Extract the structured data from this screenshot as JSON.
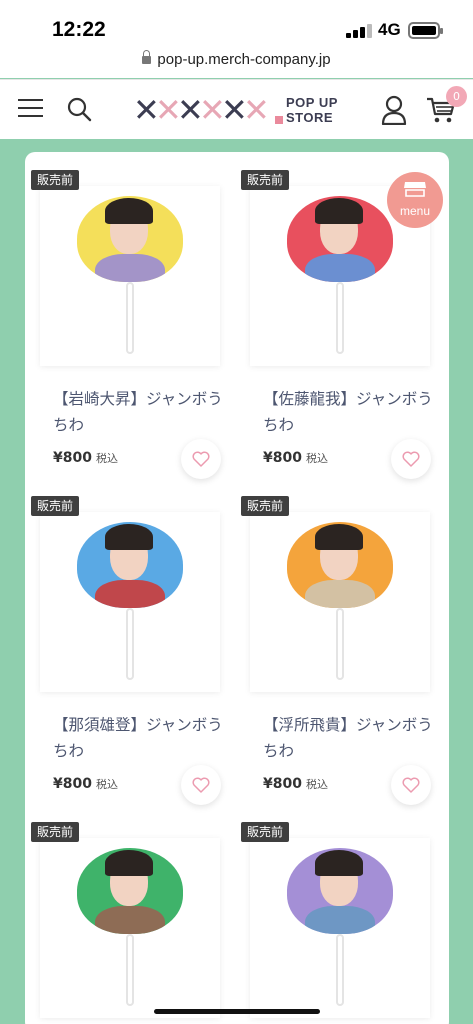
{
  "status_bar": {
    "time": "12:22",
    "network": "4G"
  },
  "browser": {
    "url": "pop-up.merch-company.jp"
  },
  "header": {
    "brand_marks": "✕✕✕✕✕✕",
    "brand_line1": "POP UP",
    "brand_line2": "STORE",
    "cart_count": "0",
    "icons": [
      "hamburger-icon",
      "search-icon",
      "user-icon",
      "cart-icon"
    ]
  },
  "menu_button": {
    "label": "menu"
  },
  "products": [
    {
      "tag": "販売前",
      "name": "【岩崎大昇】ジャンボうちわ",
      "price": "¥800",
      "tax": "税込",
      "bg": "#f4df5a",
      "body": "#a394c8"
    },
    {
      "tag": "販売前",
      "name": "【佐藤龍我】ジャンボうちわ",
      "price": "¥800",
      "tax": "税込",
      "bg": "#e8505e",
      "body": "#6b8fd1"
    },
    {
      "tag": "販売前",
      "name": "【那須雄登】ジャンボうちわ",
      "price": "¥800",
      "tax": "税込",
      "bg": "#5aa9e4",
      "body": "#c0474b"
    },
    {
      "tag": "販売前",
      "name": "【浮所飛貴】ジャンボうちわ",
      "price": "¥800",
      "tax": "税込",
      "bg": "#f4a43c",
      "body": "#d3c1a3"
    },
    {
      "tag": "販売前",
      "name": "",
      "price": "",
      "tax": "",
      "bg": "#3fb36a",
      "body": "#8e6c55"
    },
    {
      "tag": "販売前",
      "name": "",
      "price": "",
      "tax": "",
      "bg": "#a48fd6",
      "body": "#6e97c4"
    }
  ]
}
